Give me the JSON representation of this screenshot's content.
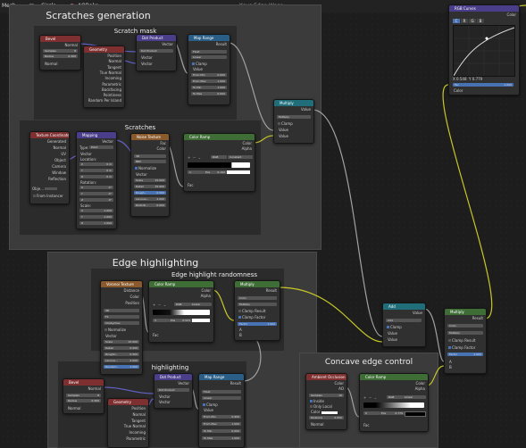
{
  "topbar": {
    "mesh_label": "Mesh",
    "breadcrumb_object": "Circle",
    "breadcrumb_material": "AOBake",
    "window_title": "Kavs Edge Wear"
  },
  "frames": {
    "scratches_generation": "Scratches generation",
    "scratch_mask": "Scratch mask",
    "scratches": "Scratches",
    "edge_highlighting": "Edge highlighting",
    "edge_highlight_randomness": "Edge highlight randomness",
    "highlighting": "highlighting",
    "concave_edge_control": "Concave edge control"
  },
  "nodes": {
    "bevel1": {
      "title": "Bevel",
      "out": "Normal",
      "samples_label": "Samples",
      "samples": "8",
      "radius_label": "Radius",
      "radius": "0.300",
      "in": "Normal"
    },
    "geometry1": {
      "title": "Geometry",
      "outputs": [
        "Position",
        "Normal",
        "Tangent",
        "True Normal",
        "Incoming",
        "Parametric",
        "Backfacing",
        "Pointiness",
        "Random Per Island"
      ]
    },
    "dot1": {
      "title": "Dot Product",
      "out": "Vector",
      "op": "Dot Product",
      "in1": "Vector",
      "in2": "Vector"
    },
    "maprange1": {
      "title": "Map Range",
      "out": "Result",
      "dtype": "Float",
      "interp": "Linear",
      "clamp": "Clamp",
      "value": "Value",
      "from_min": "0.000",
      "from_max": "1.000",
      "to_min": "1.000",
      "to_max": "0.000",
      "lbl_from_min": "From Min",
      "lbl_from_max": "From Max",
      "lbl_to_min": "To Min",
      "lbl_to_max": "To Max"
    },
    "multiply1": {
      "title": "Multiply",
      "out": "Value",
      "op": "Multiply",
      "clamp": "Clamp",
      "in1": "Value",
      "in2": "Value"
    },
    "texcoord": {
      "title": "Texture Coordinate",
      "outputs": [
        "Generated",
        "Normal",
        "UV",
        "Object",
        "Camera",
        "Window",
        "Reflection"
      ],
      "obj_label": "Obje...",
      "from_instancer": "From Instancer"
    },
    "mapping": {
      "title": "Mapping",
      "out": "Vector",
      "type_label": "Type:",
      "type": "Point",
      "in_vector": "Vector",
      "location": "Location:",
      "loc": [
        "0 m",
        "0 m",
        "0 m"
      ],
      "rotation": "Rotation:",
      "rot": [
        "0°",
        "0°",
        "0°"
      ],
      "scale": "Scale:",
      "scl": [
        "1.000",
        "1.000",
        "1.000"
      ],
      "axes": [
        "X",
        "Y",
        "Z"
      ]
    },
    "noise": {
      "title": "Noise Texture",
      "out1": "Fac",
      "out2": "Color",
      "dims": "3D",
      "basis": "fBM",
      "normalize": "Normalize",
      "vector": "Vector",
      "params": [
        [
          "Scale",
          "15.000"
        ],
        [
          "Detail",
          "15.000"
        ],
        [
          "Rough...",
          "0.500"
        ],
        [
          "Lacunar...",
          "2.000"
        ],
        [
          "Distorti...",
          "0.000"
        ]
      ]
    },
    "colorramp1": {
      "title": "Color Ramp",
      "out1": "Color",
      "out2": "Alpha",
      "mode": "RGB",
      "interp": "Constant",
      "stop": "1",
      "pos_label": "Pos",
      "pos": "0.192",
      "in": "Fac"
    },
    "voronoi": {
      "title": "Voronoi Texture",
      "outputs": [
        "Distance",
        "Color",
        "Position"
      ],
      "dims": "3D",
      "feature": "F1",
      "metric": "Chebychev",
      "normalize": "Normalize",
      "vector": "Vector",
      "params": [
        [
          "Scale",
          "15.000"
        ],
        [
          "Detail",
          "0.000"
        ],
        [
          "Roughn...",
          "0.500"
        ],
        [
          "Lacuna...",
          "2.000"
        ],
        [
          "Random...",
          "1.000"
        ]
      ]
    },
    "colorramp2": {
      "title": "Color Ramp",
      "out1": "Color",
      "out2": "Alpha",
      "mode": "RGB",
      "interp": "Linear",
      "stop": "3",
      "pos_label": "Pos",
      "pos": "0.523",
      "in": "Fac"
    },
    "multiply2": {
      "title": "Multiply",
      "out": "Result",
      "dtype": "Color",
      "op": "Multiply",
      "clamp_result": "Clamp Result",
      "clamp_factor": "Clamp Factor",
      "factor_label": "Factor",
      "factor": "1.000",
      "in1": "A",
      "in2": "B"
    },
    "add": {
      "title": "Add",
      "out": "Value",
      "op": "Add",
      "clamp": "Clamp",
      "in1": "Value",
      "in2": "Value"
    },
    "multiply3": {
      "title": "Multiply",
      "out": "Result",
      "dtype": "Color",
      "op": "Multiply",
      "clamp_result": "Clamp Result",
      "clamp_factor": "Clamp Factor",
      "factor_label": "Factor",
      "factor": "1.000",
      "in1": "A",
      "in2": "B"
    },
    "rgbcurves": {
      "title": "RGB Curves",
      "out": "Color",
      "channels": [
        "C",
        "R",
        "G",
        "B"
      ],
      "x_label": "X",
      "x": "0.548",
      "y_label": "Y",
      "y": "0.779",
      "fac_label": "Fac",
      "fac": "1.000",
      "in": "Color"
    },
    "bevel2": {
      "title": "Bevel",
      "out": "Normal",
      "samples_label": "Samples",
      "samples": "8",
      "radius_label": "Radius",
      "radius": "0.300",
      "in": "Normal"
    },
    "geometry2": {
      "title": "Geometry",
      "outputs": [
        "Position",
        "Normal",
        "Tangent",
        "True Normal",
        "Incoming",
        "Parametric"
      ]
    },
    "dot2": {
      "title": "Dot Product",
      "out": "Vector",
      "op": "Dot Product",
      "in1": "Vector",
      "in2": "Vector"
    },
    "maprange2": {
      "title": "Map Range",
      "out": "Result",
      "dtype": "Float",
      "interp": "Linear",
      "clamp": "Clamp",
      "value": "Value",
      "from_min": "0.950",
      "from_max": "1.000",
      "to_min": "0.000",
      "to_max": "1.000",
      "lbl_from_min": "From Min",
      "lbl_from_max": "From Max",
      "lbl_to_min": "To Min",
      "lbl_to_max": "To Max"
    },
    "ao": {
      "title": "Ambient Occlusion",
      "out1": "Color",
      "out2": "AO",
      "samples_label": "Samples",
      "samples": "16",
      "inside": "Inside",
      "only_local": "Only Local",
      "color": "Color",
      "distance_label": "Distance",
      "distance": "0.050",
      "normal": "Normal"
    },
    "colorramp3": {
      "title": "Color Ramp",
      "out1": "Color",
      "out2": "Alpha",
      "mode": "RGB",
      "interp": "Linear",
      "stop": "0",
      "pos_label": "Pos",
      "pos": "0.779",
      "in": "Fac"
    }
  },
  "colors": {
    "frame": "#3b3b3b",
    "wire_vector": "#6363c7",
    "wire_float": "#a1a1a1",
    "wire_color": "#c7c729",
    "socket_vector": "#6363c7",
    "socket_float": "#a1a1a1",
    "socket_color": "#c7c729",
    "selected": "#4772b3"
  }
}
